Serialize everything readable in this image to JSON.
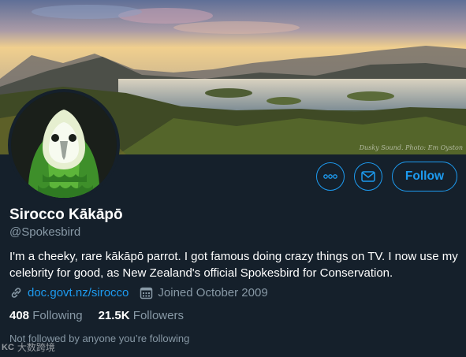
{
  "banner": {
    "credit": "Dusky Sound. Photo: Em Oyston"
  },
  "actions": {
    "more_label": "More",
    "message_label": "Message",
    "follow_label": "Follow"
  },
  "profile": {
    "name": "Sirocco Kākāpō",
    "handle": "@Spokesbird",
    "bio": "I'm a cheeky, rare kākāpō parrot. I got famous doing crazy things on TV. I now use my celebrity for good, as New Zealand's official Spokesbird for Conservation.",
    "website": "doc.govt.nz/sirocco",
    "joined": "Joined October 2009",
    "following_count": "408",
    "following_label": "Following",
    "followers_count": "21.5K",
    "followers_label": "Followers",
    "not_followed": "Not followed by anyone you’re following"
  },
  "watermark": {
    "logo": "KC",
    "text": "大数跨境"
  },
  "colors": {
    "background": "#15202b",
    "accent": "#1d9bf0",
    "muted": "#8899a6"
  },
  "icons": [
    "more-icon",
    "mail-icon",
    "link-icon",
    "calendar-icon"
  ]
}
